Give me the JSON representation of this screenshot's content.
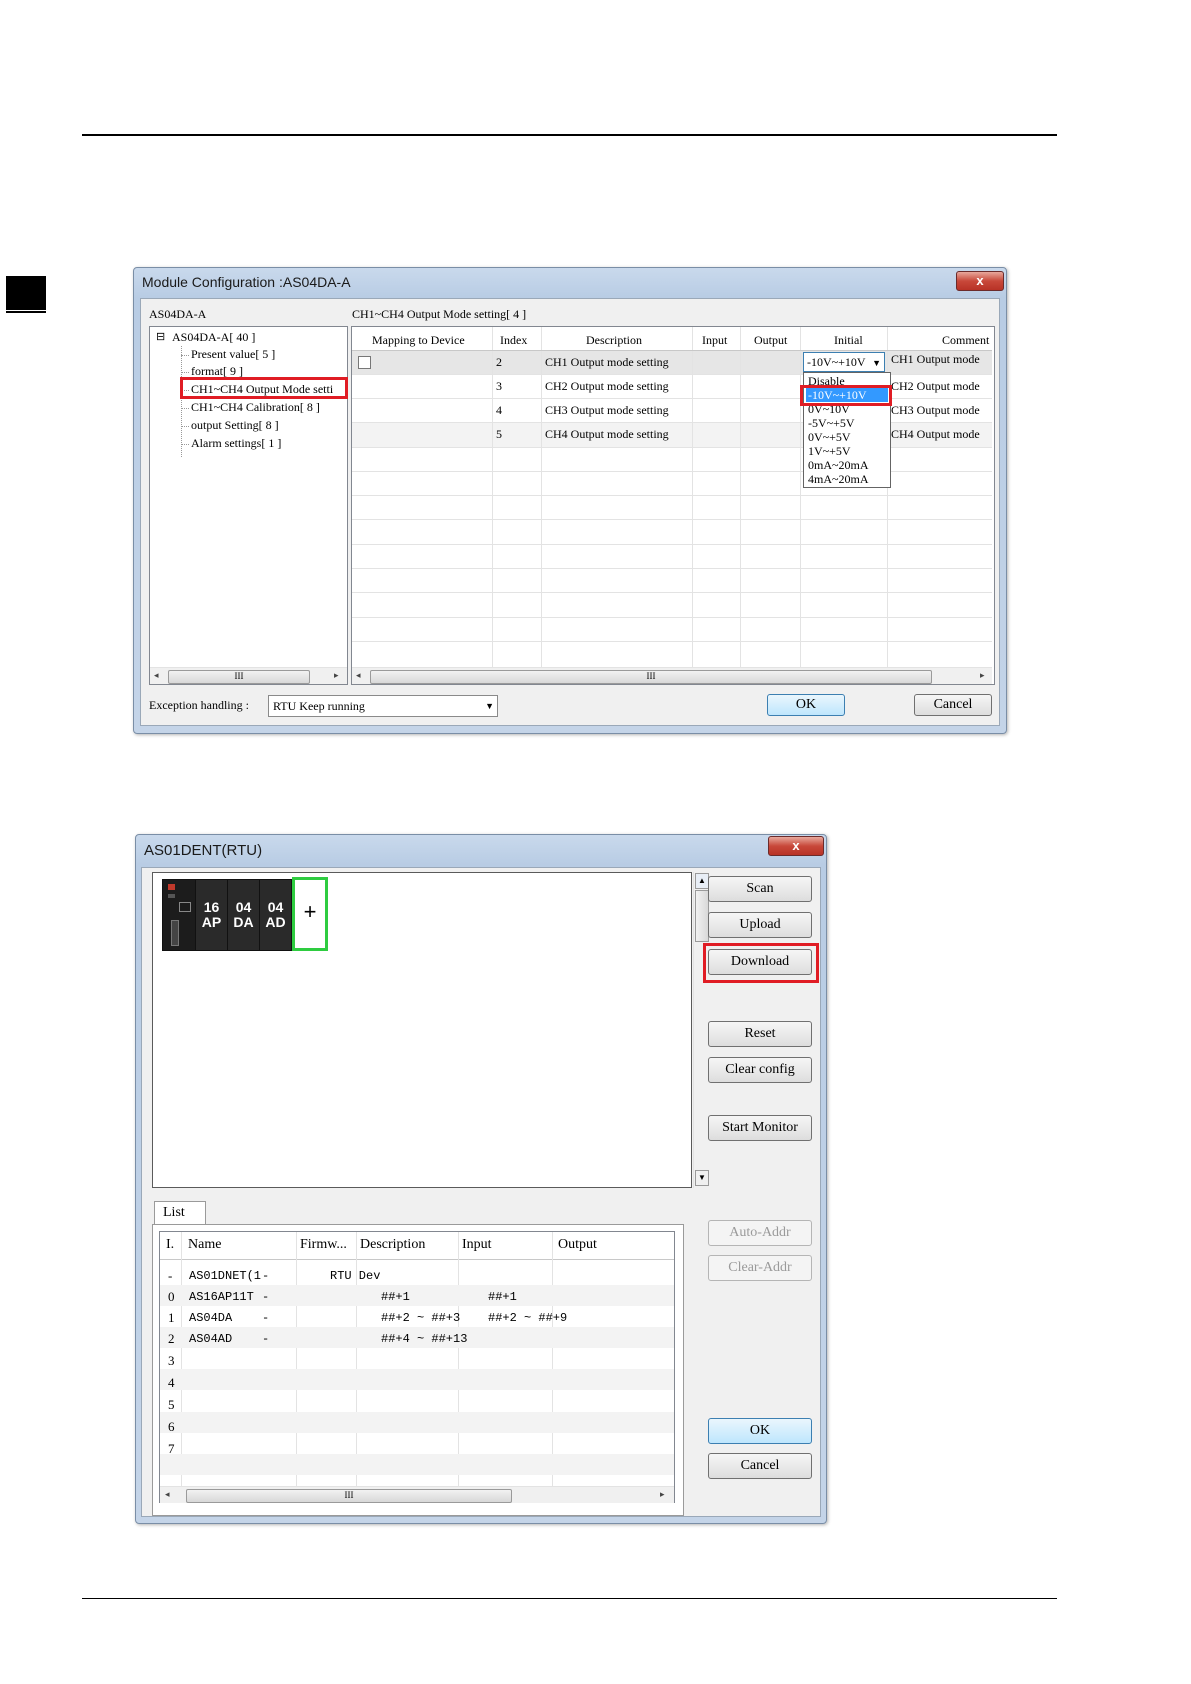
{
  "page": {
    "top_rule": true,
    "bottom_rule": true
  },
  "window1": {
    "title": "Module Configuration :AS04DA-A",
    "close_label": "x",
    "tree_header": "AS04DA-A",
    "tree": {
      "root": "AS04DA-A[ 40 ]",
      "items": [
        "Present value[ 5 ]",
        "format[ 9 ]",
        "CH1~CH4 Output Mode setti",
        "CH1~CH4 Calibration[ 8 ]",
        "output Setting[ 8 ]",
        "Alarm settings[ 1 ]"
      ]
    },
    "grid_header": "CH1~CH4 Output Mode setting[ 4 ]",
    "columns": [
      "Mapping to Device",
      "Index",
      "Description",
      "Input",
      "Output",
      "Initial",
      "Comment"
    ],
    "rows": [
      {
        "index": "2",
        "description": "CH1 Output mode setting",
        "initial": "-10V~+10V",
        "comment": "CH1 Output mode"
      },
      {
        "index": "3",
        "description": "CH2 Output mode setting",
        "initial": "",
        "comment": "CH2 Output mode"
      },
      {
        "index": "4",
        "description": "CH3 Output mode setting",
        "initial": "",
        "comment": "CH3 Output mode"
      },
      {
        "index": "5",
        "description": "CH4 Output mode setting",
        "initial": "",
        "comment": "CH4 Output mode"
      }
    ],
    "dropdown_options": [
      "Disable",
      "-10V~+10V",
      "0V~10V",
      "-5V~+5V",
      "0V~+5V",
      "1V~+5V",
      "0mA~20mA",
      "4mA~20mA"
    ],
    "dropdown_selected": "-10V~+10V",
    "exception_label": "Exception handling :",
    "exception_value": "RTU Keep running",
    "ok_label": "OK",
    "cancel_label": "Cancel",
    "scroll_grip": "III"
  },
  "window2": {
    "title": "AS01DENT(RTU)",
    "close_label": "x",
    "modules": [
      {
        "top": "16",
        "bottom": "AP"
      },
      {
        "top": "04",
        "bottom": "DA"
      },
      {
        "top": "04",
        "bottom": "AD"
      }
    ],
    "add_label": "+",
    "buttons": {
      "scan": "Scan",
      "upload": "Upload",
      "download": "Download",
      "reset": "Reset",
      "clear_config": "Clear config",
      "start_monitor": "Start Monitor",
      "auto_addr": "Auto-Addr",
      "clear_addr": "Clear-Addr",
      "ok": "OK",
      "cancel": "Cancel"
    },
    "list_tab": "List",
    "list_columns": [
      "I.",
      "Name",
      "Firmw...",
      "Description",
      "Input",
      "Output"
    ],
    "list_rows": [
      {
        "i": "-",
        "name": "AS01DNET(1",
        "firm": "-",
        "desc": "RTU Dev",
        "input": "",
        "output": ""
      },
      {
        "i": "0",
        "name": "AS16AP11T",
        "firm": "-",
        "desc": "##+1",
        "input": "##+1",
        "output": ""
      },
      {
        "i": "1",
        "name": "AS04DA",
        "firm": "-",
        "desc": "##+2 ~ ##+3",
        "input": "##+2 ~ ##+9",
        "output": ""
      },
      {
        "i": "2",
        "name": "AS04AD",
        "firm": "-",
        "desc": "##+4 ~ ##+13",
        "input": "",
        "output": ""
      },
      {
        "i": "3",
        "name": "",
        "firm": "",
        "desc": "",
        "input": "",
        "output": ""
      },
      {
        "i": "4",
        "name": "",
        "firm": "",
        "desc": "",
        "input": "",
        "output": ""
      },
      {
        "i": "5",
        "name": "",
        "firm": "",
        "desc": "",
        "input": "",
        "output": ""
      },
      {
        "i": "6",
        "name": "",
        "firm": "",
        "desc": "",
        "input": "",
        "output": ""
      },
      {
        "i": "7",
        "name": "",
        "firm": "",
        "desc": "",
        "input": "",
        "output": ""
      }
    ],
    "scroll_grip": "III"
  },
  "colors": {
    "highlight_red": "#e01c24",
    "add_green": "#2ecc40",
    "selection_blue": "#3399ff"
  }
}
